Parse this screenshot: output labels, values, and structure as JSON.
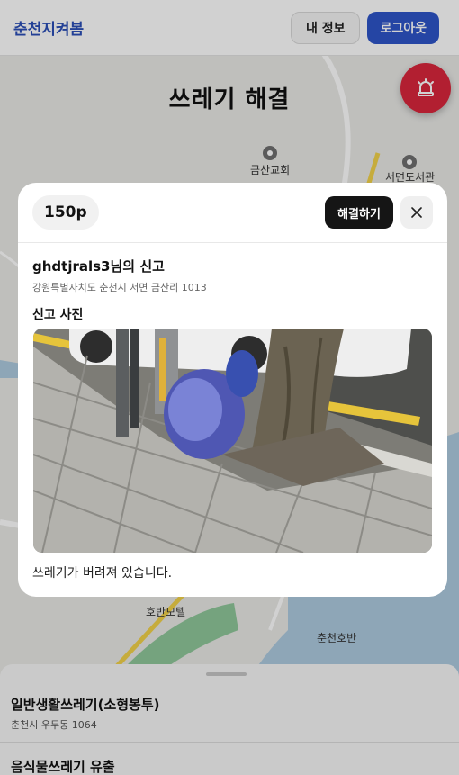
{
  "header": {
    "brand": "춘천지켜봄",
    "profile_label": "내 정보",
    "logout_label": "로그아웃"
  },
  "page": {
    "title": "쓰레기 해결"
  },
  "map": {
    "labels": [
      "금산교회",
      "서면도서관",
      "호반모텔",
      "춘천호반"
    ]
  },
  "modal": {
    "points": "150p",
    "resolve_label": "해결하기",
    "reporter": "ghdtjrals3님의 신고",
    "address": "강원특별자치도 춘천시 서면 금산리 1013",
    "photo_heading": "신고 사진",
    "description": "쓰레기가 버려져 있습니다."
  },
  "sheet": {
    "items": [
      {
        "title": "일반생활쓰레기(소형봉투)",
        "address": "춘천시 우두동 1064"
      },
      {
        "title": "음식물쓰레기 유출",
        "address": ""
      }
    ]
  },
  "icons": {
    "fab": "siren-icon",
    "close": "close-icon"
  },
  "colors": {
    "brand": "#2b4fb8",
    "logout": "#2e55c9",
    "fab": "#d9263c",
    "resolve": "#151515"
  }
}
